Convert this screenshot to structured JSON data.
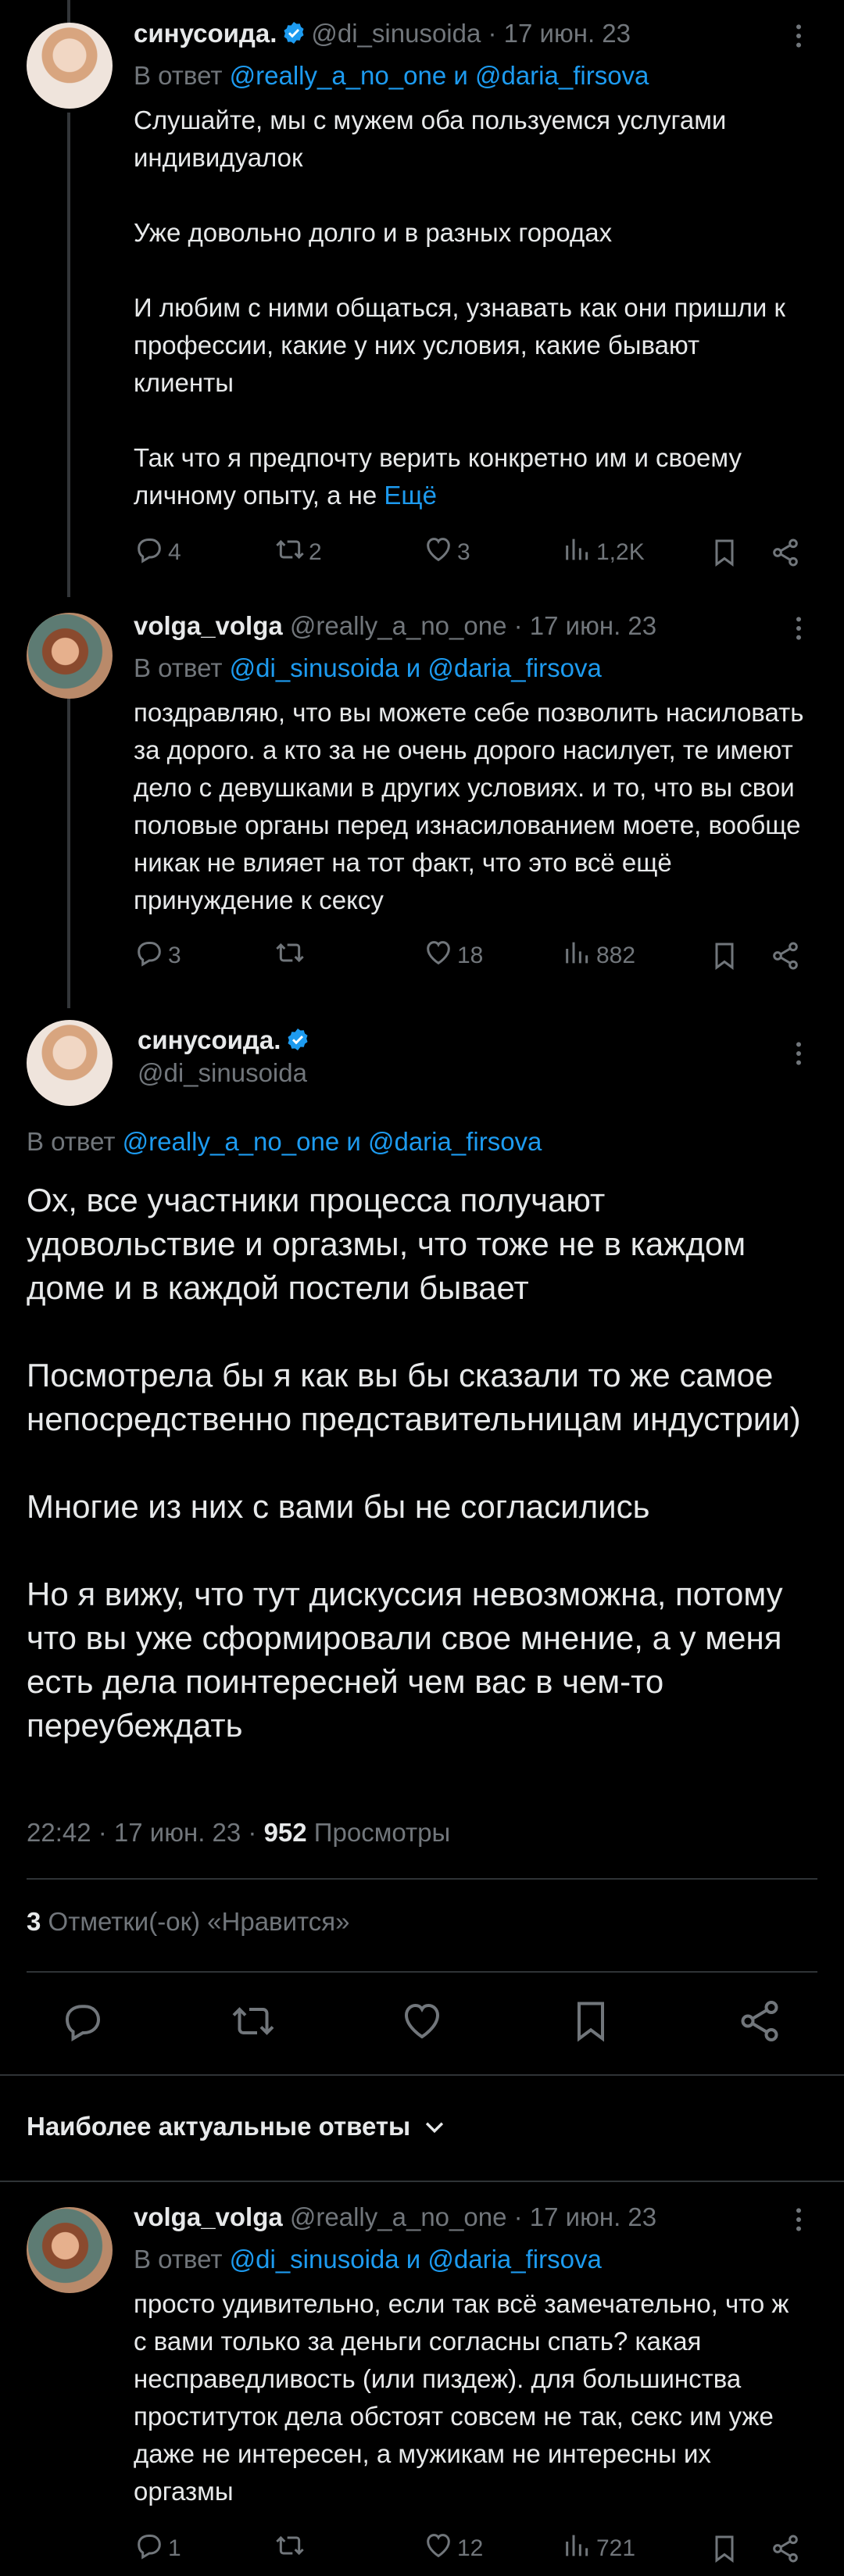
{
  "tweets": [
    {
      "name": "синусоида.",
      "handle": "@di_sinusoida",
      "date": "· 17 июн. 23",
      "reply_prefix": "В ответ",
      "reply_user1": "@really_a_no_one",
      "reply_and": "и",
      "reply_user2": "@daria_firsova",
      "paragraphs": [
        "Слушайте, мы с мужем оба пользуемся услугами индивидуалок",
        "Уже довольно долго и в разных городах",
        "И любим с ними общаться, узнавать как они пришли к профессии, какие у них условия, какие бывают клиенты",
        "Так что я предпочту верить конкретно им и своему личному опыту, а не"
      ],
      "more_link": "Ещё",
      "replies": "4",
      "retweets": "2",
      "likes": "3",
      "views": "1,2K"
    },
    {
      "name": "volga_volga",
      "handle": "@really_a_no_one",
      "date": "· 17 июн. 23",
      "reply_prefix": "В ответ",
      "reply_user1": "@di_sinusoida",
      "reply_and": "и",
      "reply_user2": "@daria_firsova",
      "paragraphs": [
        "поздравляю, что вы можете себе позволить насиловать за дорого. а кто за не очень дорого насилует, те имеют дело с девушками в других условиях. и то, что вы свои половые органы перед изнасилованием моете, вообще никак не влияет на тот факт, что это всё ещё принуждение к сексу"
      ],
      "replies": "3",
      "retweets": "",
      "likes": "18",
      "views": "882"
    }
  ],
  "main": {
    "name": "синусоида.",
    "handle": "@di_sinusoida",
    "reply_prefix": "В ответ",
    "reply_user1": "@really_a_no_one",
    "reply_and": "и",
    "reply_user2": "@daria_firsova",
    "paragraphs": [
      "Ох, все участники процесса получают удовольствие и оргазмы, что тоже не в каждом доме и в каждой постели бывает",
      "Посмотрела бы я как вы бы сказали то же самое непосредственно представительницам индустрии)",
      "Многие из них с вами бы не согласились",
      "Но я вижу, что тут дискуссия невозможна, потому что вы уже сформировали свое мнение, а у меня есть дела поинтересней чем вас в чем-то переубеждать"
    ],
    "time": "22:42 · 17 июн. 23 ·",
    "views_count": "952",
    "views_label": "Просмотры",
    "likes_count": "3",
    "likes_label": "Отметки(-ок) «Нравится»"
  },
  "sort_label": "Наиболее актуальные ответы",
  "reply_tweet": {
    "name": "volga_volga",
    "handle": "@really_a_no_one",
    "date": "· 17 июн. 23",
    "reply_prefix": "В ответ",
    "reply_user1": "@di_sinusoida",
    "reply_and": "и",
    "reply_user2": "@daria_firsova",
    "paragraphs": [
      "просто удивительно, если так всё замечательно, что ж с вами только за деньги согласны спать? какая несправедливость (или пиздеж). для большинства проституток дела обстоят совсем не так, секс им уже даже не интересен, а мужикам не интересны их оргазмы"
    ],
    "replies": "1",
    "retweets": "",
    "likes": "12",
    "views": "721"
  },
  "colors": {
    "background": "#000000",
    "text": "#e7e9ea",
    "muted": "#71767b",
    "link": "#1d9bf0",
    "divider": "#2f3336"
  },
  "icons": [
    "verified-badge-icon",
    "more-icon",
    "reply-icon",
    "retweet-icon",
    "like-icon",
    "views-icon",
    "bookmark-icon",
    "share-icon",
    "chevron-down-icon"
  ]
}
